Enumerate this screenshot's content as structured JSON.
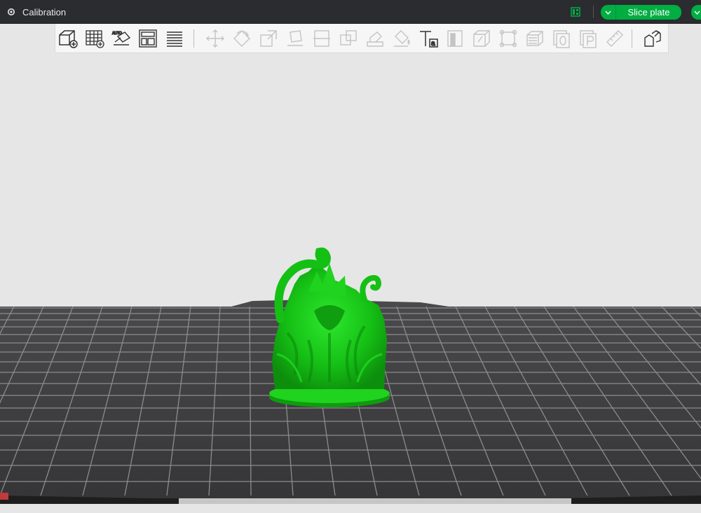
{
  "app": {
    "tab_label": "Calibration",
    "slice_button_label": "Slice plate"
  },
  "colors": {
    "accent": "#00ae42",
    "topbar": "#2a2c30",
    "bed": "#3c3c3e",
    "grid": "#8a8a8a",
    "model": "#17c417",
    "background": "#e6e6e6"
  },
  "toolbar": {
    "tools": [
      {
        "name": "add-object",
        "icon": "cube-plus-icon",
        "enabled": true
      },
      {
        "name": "add-plate",
        "icon": "grid-plus-icon",
        "enabled": true
      },
      {
        "name": "auto-orient",
        "icon": "auto-orient-icon",
        "enabled": true
      },
      {
        "name": "arrange",
        "icon": "arrange-icon",
        "enabled": true
      },
      {
        "name": "split-plates",
        "icon": "layers-icon",
        "enabled": true
      },
      {
        "name": "move",
        "icon": "move-icon",
        "enabled": false
      },
      {
        "name": "rotate",
        "icon": "rotate-icon",
        "enabled": false
      },
      {
        "name": "scale",
        "icon": "scale-icon",
        "enabled": false
      },
      {
        "name": "lay-on-face",
        "icon": "lay-on-face-icon",
        "enabled": false
      },
      {
        "name": "cut",
        "icon": "cut-icon",
        "enabled": false
      },
      {
        "name": "boolean",
        "icon": "boolean-icon",
        "enabled": false
      },
      {
        "name": "support-paint",
        "icon": "support-paint-icon",
        "enabled": false
      },
      {
        "name": "color-paint",
        "icon": "paint-bucket-icon",
        "enabled": false
      },
      {
        "name": "text",
        "icon": "text-icon",
        "enabled": true
      },
      {
        "name": "seam-paint",
        "icon": "seam-paint-icon",
        "enabled": false
      },
      {
        "name": "mesh-boolean",
        "icon": "mesh-icon",
        "enabled": false
      },
      {
        "name": "measure",
        "icon": "measure-frame-icon",
        "enabled": false
      },
      {
        "name": "assembly",
        "icon": "stack-icon",
        "enabled": false
      },
      {
        "name": "variable-layer",
        "icon": "zero-icon",
        "enabled": false
      },
      {
        "name": "plate-p",
        "icon": "p-icon",
        "enabled": false
      },
      {
        "name": "ruler",
        "icon": "ruler-icon",
        "enabled": false
      },
      {
        "name": "explode",
        "icon": "explode-icon",
        "enabled": true
      }
    ]
  }
}
